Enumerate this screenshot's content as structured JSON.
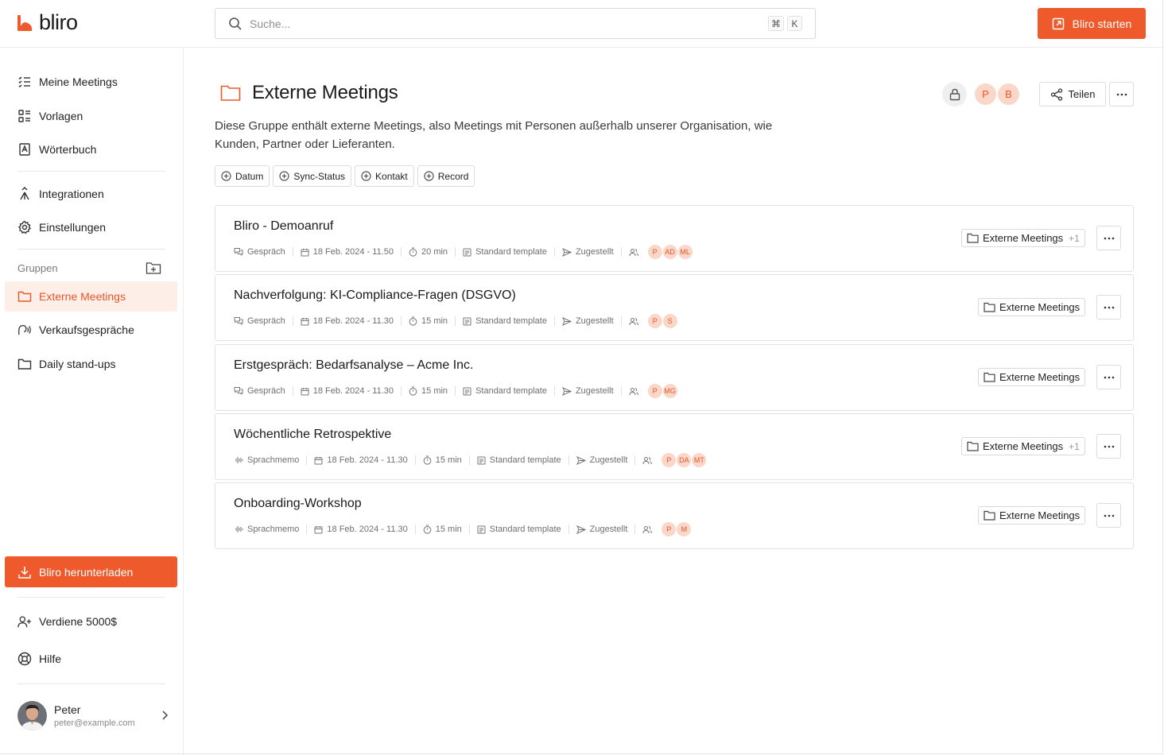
{
  "app": {
    "logo_text": "bliro",
    "start_label": "Bliro starten"
  },
  "search": {
    "placeholder": "Suche...",
    "shortcut_cmd": "⌘",
    "shortcut_key": "K"
  },
  "colors": {
    "accent": "#ee5a2b",
    "accent_light": "#fdeee7"
  },
  "sidebar": {
    "nav": [
      {
        "label": "Meine Meetings",
        "icon": "list-icon"
      },
      {
        "label": "Vorlagen",
        "icon": "template-icon"
      },
      {
        "label": "Wörterbuch",
        "icon": "dictionary-icon"
      },
      {
        "label": "Integrationen",
        "icon": "integration-icon"
      },
      {
        "label": "Einstellungen",
        "icon": "gear-icon"
      }
    ],
    "groups_label": "Gruppen",
    "groups": [
      {
        "label": "Externe Meetings",
        "icon": "folder-icon",
        "active": true
      },
      {
        "label": "Verkaufsgespräche",
        "icon": "voice-icon"
      },
      {
        "label": "Daily stand-ups",
        "icon": "folder-icon"
      }
    ],
    "download_label": "Bliro herunterladen",
    "earn_label": "Verdiene 5000$",
    "help_label": "Hilfe",
    "user": {
      "name": "Peter",
      "email": "peter@example.com"
    }
  },
  "main": {
    "title": "Externe Meetings",
    "description": "Diese Gruppe enthält externe Meetings, also Meetings mit Personen außerhalb unserer Organisation, wie Kunden, Partner oder Lieferanten.",
    "members": [
      "P",
      "B"
    ],
    "share_label": "Teilen",
    "filters": [
      "Datum",
      "Sync-Status",
      "Kontakt",
      "Record"
    ],
    "meetings": [
      {
        "title": "Bliro - Demoanruf",
        "type": "Gespräch",
        "type_icon": "chat-icon",
        "date": "18 Feb. 2024 - 11.50",
        "duration": "20 min",
        "template": "Standard template",
        "status": "Zugestellt",
        "participants": [
          "P",
          "AD",
          "ML"
        ],
        "group": "Externe Meetings",
        "extra": "+1"
      },
      {
        "title": "Nachverfolgung: KI-Compliance-Fragen (DSGVO)",
        "type": "Gespräch",
        "type_icon": "chat-icon",
        "date": "18 Feb. 2024 - 11.30",
        "duration": "15 min",
        "template": "Standard template",
        "status": "Zugestellt",
        "participants": [
          "P",
          "S"
        ],
        "group": "Externe Meetings",
        "extra": ""
      },
      {
        "title": "Erstgespräch: Bedarfsanalyse – Acme Inc.",
        "type": "Gespräch",
        "type_icon": "chat-icon",
        "date": "18 Feb. 2024 - 11.30",
        "duration": "15 min",
        "template": "Standard template",
        "status": "Zugestellt",
        "participants": [
          "P",
          "MG"
        ],
        "group": "Externe Meetings",
        "extra": ""
      },
      {
        "title": "Wöchentliche Retrospektive",
        "type": "Sprachmemo",
        "type_icon": "waveform-icon",
        "date": "18 Feb. 2024 - 11.30",
        "duration": "15 min",
        "template": "Standard template",
        "status": "Zugestellt",
        "participants": [
          "P",
          "DA",
          "MT"
        ],
        "group": "Externe Meetings",
        "extra": "+1"
      },
      {
        "title": "Onboarding-Workshop",
        "type": "Sprachmemo",
        "type_icon": "waveform-icon",
        "date": "18 Feb. 2024 - 11.30",
        "duration": "15 min",
        "template": "Standard template",
        "status": "Zugestellt",
        "participants": [
          "P",
          "M"
        ],
        "group": "Externe Meetings",
        "extra": ""
      }
    ]
  }
}
